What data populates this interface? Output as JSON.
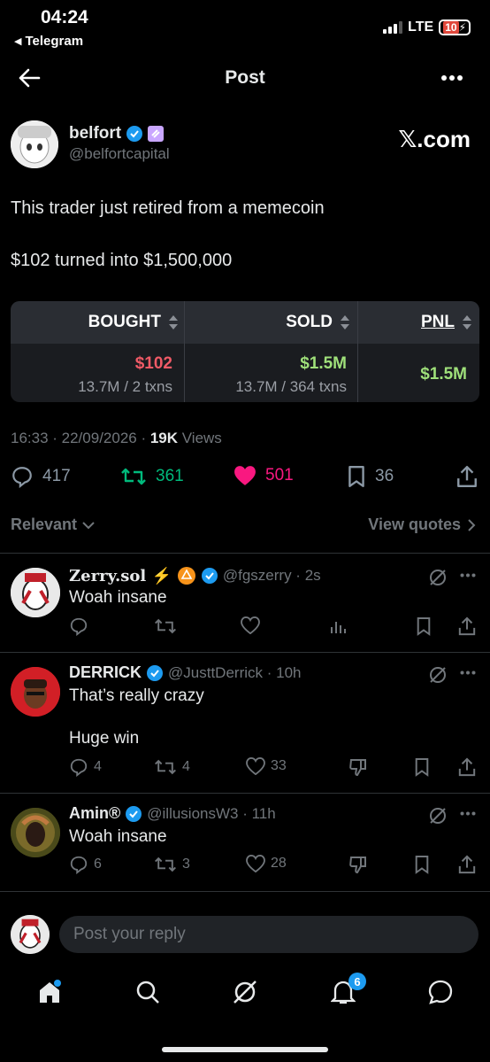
{
  "status": {
    "time": "04:24",
    "back_app": "Telegram",
    "network": "LTE",
    "battery": "10"
  },
  "header": {
    "title": "Post"
  },
  "author": {
    "name": "belfort",
    "handle": "@belfortcapital",
    "source": "𝕏.com"
  },
  "post": {
    "line1": "This trader just retired from a memecoin",
    "line2": "$102 turned into $1,500,000",
    "pnl_card": {
      "bought_label": "BOUGHT",
      "sold_label": "SOLD",
      "pnl_label": "PNL",
      "bought_value": "$102",
      "bought_detail": "13.7M / 2 txns",
      "sold_value": "$1.5M",
      "sold_detail": "13.7M / 364 txns",
      "pnl_value": "$1.5M"
    },
    "time": "16:33 · 22/09/2026 · ",
    "views_count": "19K",
    "views_label": " Views",
    "replies": "417",
    "reposts": "361",
    "likes": "501",
    "bookmarks": "36"
  },
  "filter": {
    "relevant": "Relevant",
    "view_quotes": "View quotes"
  },
  "replies": [
    {
      "name": "Zerry.sol ⚡",
      "handle": "@fgszerry · 2s",
      "text": "Woah insane",
      "replies": "",
      "reposts": "",
      "likes": ""
    },
    {
      "name": "DERRICK",
      "handle": "@JusttDerrick · 10h",
      "text": "That’s really crazy",
      "text2": "Huge win",
      "replies": "4",
      "reposts": "4",
      "likes": "33"
    },
    {
      "name": "Amin®",
      "handle": "@illusionsW3 · 11h",
      "text": "Woah insane",
      "replies": "6",
      "reposts": "3",
      "likes": "28"
    }
  ],
  "compose": {
    "placeholder": "Post your reply"
  },
  "tabbar": {
    "notifications_badge": "6"
  },
  "colors": {
    "accent": "#1d9bf0",
    "like": "#f91880",
    "repost": "#00ba7c",
    "profit": "#9fe07a",
    "loss": "#f05a66"
  }
}
